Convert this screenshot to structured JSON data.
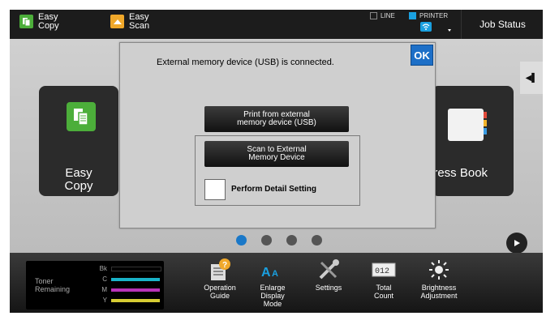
{
  "topbar": {
    "easy_copy": "Easy\nCopy",
    "easy_scan": "Easy\nScan",
    "line_label": "LINE",
    "printer_label": "PRINTER",
    "job_status": "Job Status"
  },
  "home": {
    "left_tile_label": "Easy\nCopy",
    "right_tile_label": "dress Book"
  },
  "dialog": {
    "message": "External memory device (USB) is connected.",
    "ok_label": "OK",
    "print_button": "Print from external\nmemory device (USB)",
    "scan_button": "Scan to External\nMemory Device",
    "detail_setting_label": "Perform Detail Setting"
  },
  "pagination": {
    "count": 4,
    "active_index": 0
  },
  "bottombar": {
    "toner_title": "Toner\nRemaining",
    "toner": [
      {
        "letter": "Bk",
        "color": "#000000"
      },
      {
        "letter": "C",
        "color": "#19b3c8"
      },
      {
        "letter": "M",
        "color": "#b833b8"
      },
      {
        "letter": "Y",
        "color": "#d6cc33"
      }
    ],
    "items": [
      {
        "label": "Operation\nGuide",
        "icon": "operation-guide-icon"
      },
      {
        "label": "Enlarge\nDisplay\nMode",
        "icon": "enlarge-display-icon"
      },
      {
        "label": "Settings",
        "icon": "settings-icon"
      },
      {
        "label": "Total\nCount",
        "icon": "total-count-icon"
      },
      {
        "label": "Brightness\nAdjustment",
        "icon": "brightness-icon"
      }
    ]
  },
  "colors": {
    "accent": "#1d6fc7",
    "easy_copy_icon": "#4cae3a",
    "easy_scan_icon": "#f0a82a",
    "dot_active": "#1a78c8"
  }
}
